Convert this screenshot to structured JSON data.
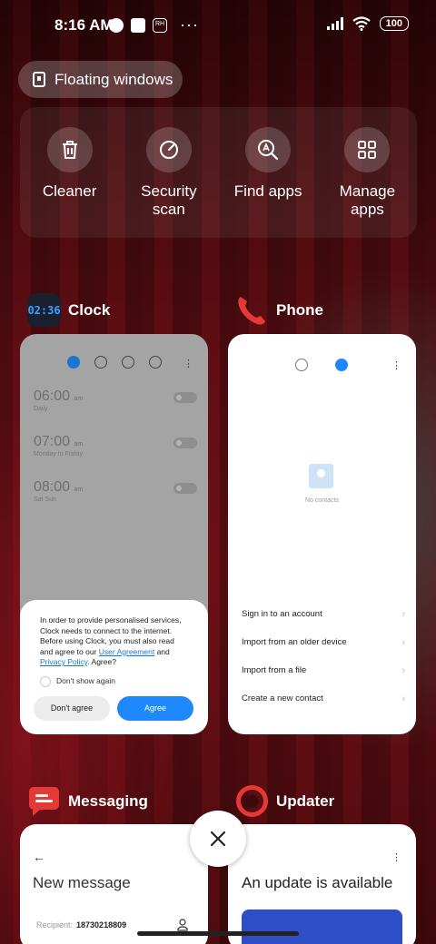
{
  "status_bar": {
    "time": "8:16 AM",
    "battery": "100",
    "left_icons": [
      "app-notification-icon",
      "square-notification-icon",
      "rh-badge-icon"
    ],
    "right_icons": [
      "signal-icon",
      "wifi-icon",
      "battery-icon"
    ]
  },
  "floating_windows": {
    "label": "Floating windows",
    "icon": "floating-window-icon"
  },
  "quick_actions": [
    {
      "label": "Cleaner",
      "icon": "trash-icon"
    },
    {
      "label": "Security scan",
      "icon": "security-scan-icon"
    },
    {
      "label": "Find apps",
      "icon": "find-apps-icon"
    },
    {
      "label": "Manage apps",
      "icon": "grid-icon"
    }
  ],
  "apps": {
    "clock": {
      "name": "Clock",
      "icon_text": "02:36",
      "alarms": [
        {
          "time": "06:00",
          "ampm": "am",
          "repeat": "Daily"
        },
        {
          "time": "07:00",
          "ampm": "am",
          "repeat": "Monday to Friday"
        },
        {
          "time": "08:00",
          "ampm": "am",
          "repeat": "Sat Sun"
        }
      ],
      "consent": {
        "text_1": "In order to provide personalised services, Clock needs to connect to the internet. Before using Clock, you must also read and agree to our",
        "link_1": "User Agreement",
        "and": "and",
        "link_2": "Privacy Policy",
        "text_2": ". Agree?",
        "checkbox_label": "Don't show again",
        "disagree": "Don't agree",
        "agree": "Agree"
      }
    },
    "phone": {
      "name": "Phone",
      "no_contacts": "No contacts",
      "options": [
        "Sign in to an account",
        "Import from an older device",
        "Import from a file",
        "Create a new contact"
      ]
    },
    "messaging": {
      "name": "Messaging",
      "title": "New message",
      "recipient_label": "Recipient:",
      "recipient_value": "18730218809"
    },
    "updater": {
      "name": "Updater",
      "title": "An update is available"
    }
  },
  "colors": {
    "accent_blue": "#1e88ff",
    "phone_red": "#e53935",
    "messaging_red": "#e53935"
  }
}
